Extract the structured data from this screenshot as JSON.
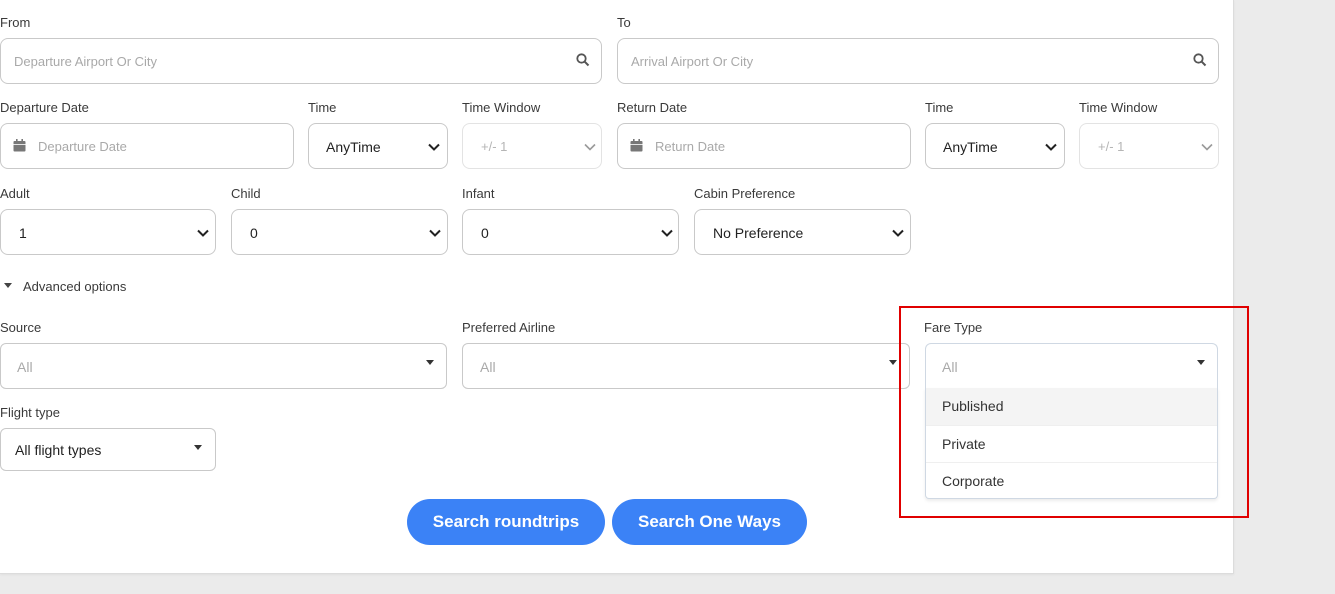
{
  "from": {
    "label": "From",
    "placeholder": "Departure Airport Or City"
  },
  "to": {
    "label": "To",
    "placeholder": "Arrival Airport Or City"
  },
  "departure": {
    "date_label": "Departure Date",
    "date_placeholder": "Departure Date",
    "time_label": "Time",
    "time_value": "AnyTime",
    "window_label": "Time Window",
    "window_value": "+/- 1"
  },
  "return": {
    "date_label": "Return Date",
    "date_placeholder": "Return Date",
    "time_label": "Time",
    "time_value": "AnyTime",
    "window_label": "Time Window",
    "window_value": "+/- 1"
  },
  "passengers": {
    "adult_label": "Adult",
    "adult_value": "1",
    "child_label": "Child",
    "child_value": "0",
    "infant_label": "Infant",
    "infant_value": "0"
  },
  "cabin": {
    "label": "Cabin Preference",
    "value": "No Preference"
  },
  "advanced": {
    "label": "Advanced options"
  },
  "source": {
    "label": "Source",
    "placeholder": "All"
  },
  "airline": {
    "label": "Preferred Airline",
    "placeholder": "All"
  },
  "fare_type": {
    "label": "Fare Type",
    "placeholder": "All",
    "options": [
      "Published",
      "Private",
      "Corporate"
    ]
  },
  "flight_type": {
    "label": "Flight type",
    "value": "All flight types"
  },
  "buttons": {
    "roundtrips": "Search roundtrips",
    "oneways": "Search One Ways"
  },
  "colors": {
    "primary": "#3b82f6",
    "highlight": "#e00000"
  },
  "icons": {
    "search": "search-icon",
    "calendar": "calendar-icon",
    "chevron": "chevron-down-icon",
    "caret": "caret-down-icon"
  }
}
